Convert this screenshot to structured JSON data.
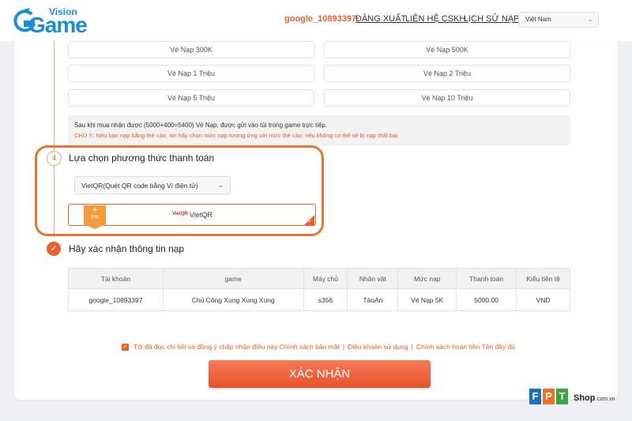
{
  "header": {
    "logo_small": "Vision",
    "logo_big": "Game",
    "username": "google_10893397",
    "nav": [
      "ĐĂNG XUẤT",
      "LIÊN HỆ CSKH",
      "LỊCH SỬ NẠP"
    ],
    "language": "Việt Nam"
  },
  "packages": [
    "Vé Nạp 300K",
    "Vé Nạp 500K",
    "Vé Nạp 1 Triệu",
    "Vé Nạp 2 Triệu",
    "Vé Nạp 5 Triệu",
    "Vé Nạp 10 Triệu"
  ],
  "notice": {
    "line1": "Sau khi mua nhận được (5000+400=5400) Vé Nạp, được gửi vào túi trong game trực tiếp.",
    "line2": "CHÚ Ý: Nếu bạn nạp bằng thẻ cào, xin hãy chọn mức nạp tương ứng với mức thẻ cào, nếu không có thể sẽ bị nạp thất bại."
  },
  "payment": {
    "step_number": "4",
    "title": "Lựa chọn phương thức thanh toán",
    "selected_method": "VietQR(Quét QR code bằng Ví điện tử)",
    "option_label": "VietQR",
    "option_logo": "VietQR",
    "bonus_plus": "+",
    "bonus_percent": "8%"
  },
  "confirm": {
    "title": "Hãy xác nhận thông tin nạp",
    "columns": [
      "Tài khoản",
      "game",
      "Máy chủ",
      "Nhân vật",
      "Mức nạp",
      "Thanh toán",
      "Kiểu tiền tệ"
    ],
    "row": [
      "google_10893397",
      "Chủ Công Xung Xung Xung",
      "s356",
      "TàoAn",
      "Vé Nạp 5K",
      "5000.00",
      "VND"
    ]
  },
  "agreement": {
    "text": "Tôi đã đọc chi tiết và đồng ý chấp nhận điều này",
    "links": [
      "Chính sách bảo mật",
      "Điều khoản sử dụng",
      "Chính sách hoàn tiền",
      "Tên đầy đủ"
    ]
  },
  "submit_label": "XÁC NHẬN",
  "watermark": {
    "letters": [
      "F",
      "P",
      "T"
    ],
    "shop": "Shop",
    "domain": ".com.vn"
  },
  "colors": {
    "accent": "#e8632b",
    "brand_blue": "#1a8ed8",
    "highlight": "#e8762f"
  }
}
